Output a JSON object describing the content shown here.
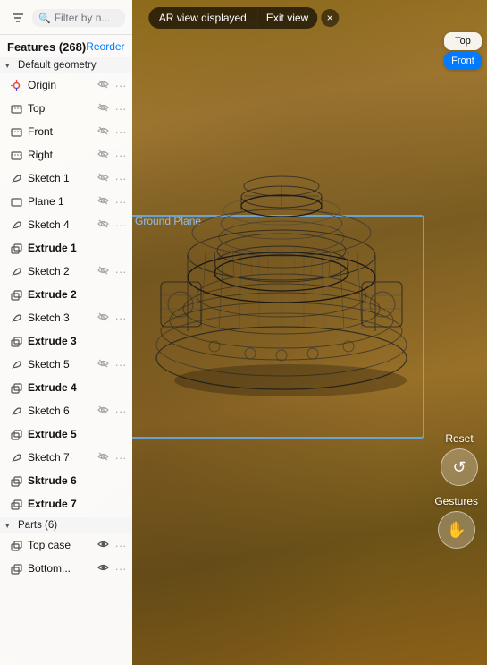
{
  "ar_banner": {
    "displayed_label": "AR view displayed",
    "exit_label": "Exit view",
    "close_icon": "×"
  },
  "sidebar": {
    "filter_icon": "⧉",
    "search_placeholder": "Filter by n...",
    "features_title": "Features",
    "features_count": "(268)",
    "reorder_label": "Reorder",
    "section_default": "Default geometry",
    "items": [
      {
        "icon": "dot",
        "name": "Origin",
        "type": "origin"
      },
      {
        "icon": "box",
        "name": "Top",
        "type": "plane"
      },
      {
        "icon": "box",
        "name": "Front",
        "type": "plane"
      },
      {
        "icon": "box",
        "name": "Right",
        "type": "plane"
      },
      {
        "icon": "pen",
        "name": "Sketch 1",
        "type": "sketch"
      },
      {
        "icon": "box",
        "name": "Plane 1",
        "type": "plane"
      },
      {
        "icon": "pen",
        "name": "Sketch 4",
        "type": "sketch"
      },
      {
        "icon": "extrude",
        "name": "Extrude 1",
        "type": "extrude",
        "bold": true
      },
      {
        "icon": "pen",
        "name": "Sketch 2",
        "type": "sketch"
      },
      {
        "icon": "extrude",
        "name": "Extrude 2",
        "type": "extrude",
        "bold": true
      },
      {
        "icon": "pen",
        "name": "Sketch 3",
        "type": "sketch"
      },
      {
        "icon": "extrude",
        "name": "Extrude 3",
        "type": "extrude",
        "bold": true
      },
      {
        "icon": "pen",
        "name": "Sketch 5",
        "type": "sketch"
      },
      {
        "icon": "extrude",
        "name": "Extrude 4",
        "type": "extrude",
        "bold": true
      },
      {
        "icon": "pen",
        "name": "Sketch 6",
        "type": "sketch"
      },
      {
        "icon": "extrude",
        "name": "Extrude 5",
        "type": "extrude",
        "bold": true
      },
      {
        "icon": "pen",
        "name": "Sketch 7",
        "type": "sketch"
      },
      {
        "icon": "extrude",
        "name": "Sktrude 6",
        "type": "extrude",
        "bold": true
      },
      {
        "icon": "extrude",
        "name": "Extrude 7",
        "type": "extrude",
        "bold": true
      }
    ],
    "parts_section": "Parts",
    "parts_count": "(6)",
    "parts": [
      {
        "name": "Top case",
        "visible": true
      },
      {
        "name": "Bottom...",
        "visible": true
      }
    ]
  },
  "view_buttons": [
    {
      "label": "Top",
      "selected": false
    },
    {
      "label": "Front",
      "selected": true
    }
  ],
  "ground_label": "Ground Plane",
  "reset": {
    "label": "Reset",
    "icon": "↺"
  },
  "gestures": {
    "label": "Gestures",
    "icon": "✋"
  }
}
